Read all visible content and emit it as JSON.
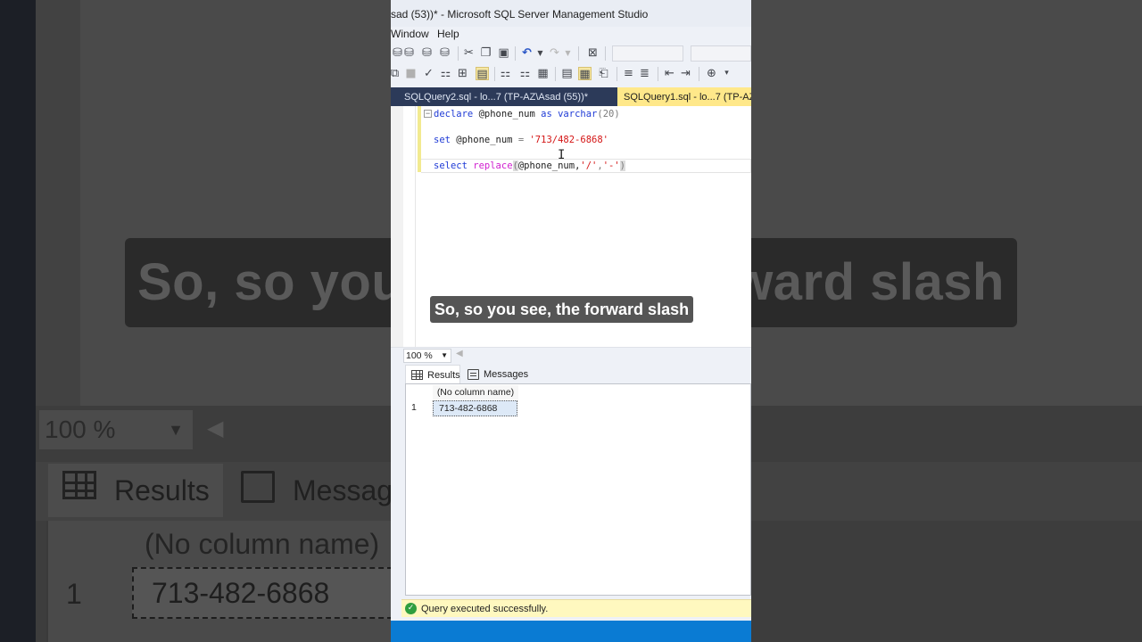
{
  "window": {
    "title": "sad (53))* - Microsoft SQL Server Management Studio"
  },
  "menu": {
    "window": "Window",
    "help": "Help"
  },
  "tabs": [
    {
      "label": "SQLQuery2.sql - lo...7 (TP-AZ\\Asad (55))*",
      "active": false
    },
    {
      "label": "SQLQuery1.sql - lo...7 (TP-AZ\\A",
      "active": true
    }
  ],
  "editor": {
    "line1": {
      "kw1": "declare",
      "var": " @phone_num ",
      "kw2": "as",
      "sp": " ",
      "type": "varchar",
      "args": "(20)"
    },
    "line2": {
      "kw": "set",
      "rest": " @phone_num ",
      "op": "=",
      "sp": " ",
      "str": "'713/482-6868'"
    },
    "line3": {
      "kw": "select",
      "sp": " ",
      "fn": "replace",
      "open": "(",
      "arg": "@phone_num,",
      "s1": "'/'",
      "comma": ",",
      "s2": "'-'",
      "close": ")"
    }
  },
  "caption": {
    "text": "So, so you see, the forward slash",
    "bg_left": "So, so you",
    "bg_right": "ward slash"
  },
  "zoom": {
    "value": "100 %"
  },
  "results": {
    "tab_results": "Results",
    "tab_messages": "Messages",
    "columns": [
      "(No column name)"
    ],
    "rows": [
      {
        "num": "1",
        "value": "713-482-6868"
      }
    ]
  },
  "status": {
    "text": "Query executed successfully."
  },
  "background": {
    "zoom": "100 %",
    "results": "Results",
    "messages": "Message",
    "column": "(No column name)",
    "row_num": "1",
    "cell": "713-482-6868"
  },
  "colors": {
    "accent_blue": "#0a7bd3",
    "tab_active": "#ffe88a",
    "status_bg": "#fff8bf"
  }
}
